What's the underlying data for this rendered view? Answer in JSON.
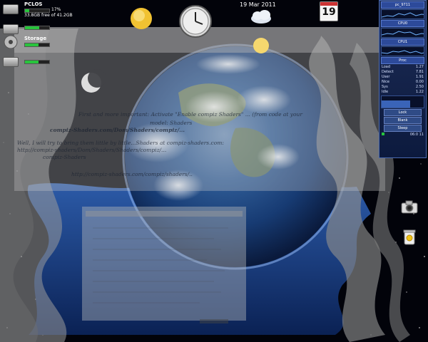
{
  "disks": [
    {
      "name": "PCLOS",
      "used_pct": 0.17,
      "pct_label": "17%",
      "free": "33.8GB free of 41.2GB"
    },
    {
      "name": "Storage",
      "used_pct": 0.6,
      "pct_label": "",
      "free": ""
    },
    {
      "name": "",
      "used_pct": 0.55,
      "pct_label": "",
      "free": ""
    }
  ],
  "top_dock": {
    "date": "19 Mar 2011",
    "calendar_day": "19",
    "icons": [
      "sun-weather-icon",
      "clock-icon",
      "cloud-weather-icon"
    ]
  },
  "document": {
    "lines": [
      {
        "text": "First and more important: Activate \"Enable compiz Shaders\" ... (from code at your",
        "bold": false
      },
      {
        "text": "model: Shaders",
        "bold": false
      },
      {
        "text": "compiz-Shaders.com/Dom/Shaders/compiz/...",
        "bold": true
      },
      {
        "text": "Well, I will try to bring them little by little...Shaders at compiz-shaders.com:",
        "bold": false
      },
      {
        "text": "http://compiz-shaders/Dom/Shaders/Shaders/compiz/...",
        "bold": false
      },
      {
        "text": "compiz-Shaders",
        "bold": false
      },
      {
        "text": "http://compiz-shaders.com/compiz/shaders/..",
        "bold": false
      }
    ]
  },
  "sysmon": {
    "title": "pc_9711",
    "sections": [
      "CPU0",
      "CPU1",
      "Proc"
    ],
    "rows": [
      {
        "label": "Load",
        "value": "1.27"
      },
      {
        "label": "Detect",
        "value": "7.81"
      },
      {
        "label": "User",
        "value": "1.91"
      },
      {
        "label": "Nice",
        "value": "0.00"
      },
      {
        "label": "Sys",
        "value": "2.50"
      },
      {
        "label": "Idle",
        "value": "1.22"
      }
    ],
    "buttons": [
      "Lock",
      "Blank",
      "Sleep"
    ],
    "footer": "06:0 11"
  },
  "colors": {
    "disk_bar": "#27c43c",
    "sysmon_bg": "#1d2c56",
    "wave_gray": "#8c8c8c",
    "ocean_blue": "#1a3e8c"
  }
}
